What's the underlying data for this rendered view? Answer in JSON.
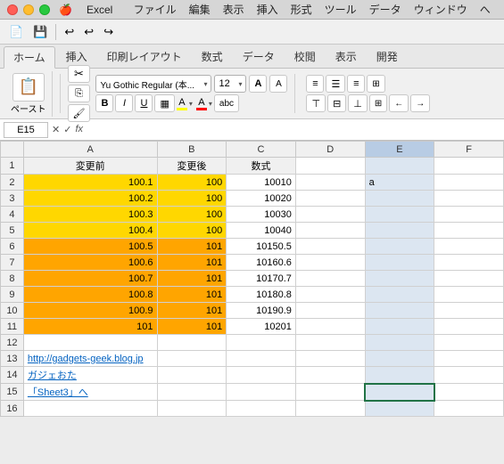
{
  "titlebar": {
    "app": "Excel",
    "title": "Excel",
    "menus": [
      "ファイル",
      "編集",
      "表示",
      "挿入",
      "形式",
      "ツール",
      "データ",
      "ウィンドウ",
      "へ"
    ]
  },
  "ribbon": {
    "tabs": [
      "ホーム",
      "挿入",
      "印刷レイアウト",
      "数式",
      "データ",
      "校閲",
      "表示",
      "開発"
    ],
    "active_tab": "ホーム",
    "font_name": "Yu Gothic Regular (本...",
    "font_size": "12",
    "paste_label": "ペースト"
  },
  "formula_bar": {
    "cell_ref": "E15",
    "formula": "fx"
  },
  "columns": [
    "",
    "A",
    "B",
    "C",
    "D",
    "E",
    "F"
  ],
  "rows": [
    {
      "row": 1,
      "A": "変更前",
      "B": "変更後",
      "C": "数式",
      "D": "",
      "E": "",
      "F": ""
    },
    {
      "row": 2,
      "A": "100.1",
      "B": "100",
      "C": "10010",
      "D": "",
      "E": "a",
      "F": ""
    },
    {
      "row": 3,
      "A": "100.2",
      "B": "100",
      "C": "10020",
      "D": "",
      "E": "",
      "F": ""
    },
    {
      "row": 4,
      "A": "100.3",
      "B": "100",
      "C": "10030",
      "D": "",
      "E": "",
      "F": ""
    },
    {
      "row": 5,
      "A": "100.4",
      "B": "100",
      "C": "10040",
      "D": "",
      "E": "",
      "F": ""
    },
    {
      "row": 6,
      "A": "100.5",
      "B": "101",
      "C": "10150.5",
      "D": "",
      "E": "",
      "F": ""
    },
    {
      "row": 7,
      "A": "100.6",
      "B": "101",
      "C": "10160.6",
      "D": "",
      "E": "",
      "F": ""
    },
    {
      "row": 8,
      "A": "100.7",
      "B": "101",
      "C": "10170.7",
      "D": "",
      "E": "",
      "F": ""
    },
    {
      "row": 9,
      "A": "100.8",
      "B": "101",
      "C": "10180.8",
      "D": "",
      "E": "",
      "F": ""
    },
    {
      "row": 10,
      "A": "100.9",
      "B": "101",
      "C": "10190.9",
      "D": "",
      "E": "",
      "F": ""
    },
    {
      "row": 11,
      "A": "101",
      "B": "101",
      "C": "10201",
      "D": "",
      "E": "",
      "F": ""
    },
    {
      "row": 12,
      "A": "",
      "B": "",
      "C": "",
      "D": "",
      "E": "",
      "F": ""
    },
    {
      "row": 13,
      "A": "http://gadgets-geek.blog.jp",
      "B": "",
      "C": "",
      "D": "",
      "E": "",
      "F": ""
    },
    {
      "row": 14,
      "A": "ガジェおた",
      "B": "",
      "C": "",
      "D": "",
      "E": "",
      "F": ""
    },
    {
      "row": 15,
      "A": "「Sheet3」へ",
      "B": "",
      "C": "",
      "D": "",
      "E": "",
      "F": ""
    },
    {
      "row": 16,
      "A": "",
      "B": "",
      "C": "",
      "D": "",
      "E": "",
      "F": ""
    }
  ]
}
